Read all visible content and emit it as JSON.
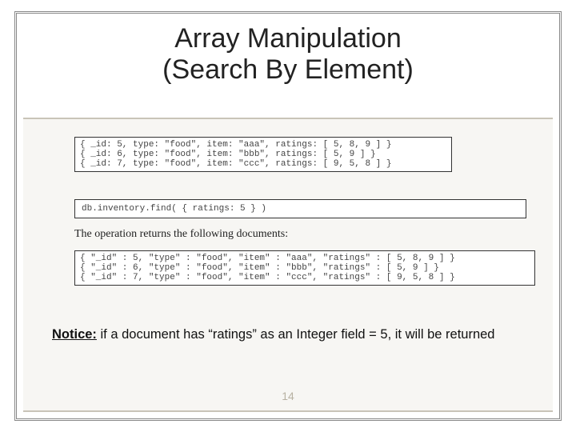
{
  "title": {
    "line1": "Array Manipulation",
    "line2": "(Search By Element)"
  },
  "data_docs": [
    "{ _id: 5, type: \"food\", item: \"aaa\", ratings: [ 5, 8, 9 ] }",
    "{ _id: 6, type: \"food\", item: \"bbb\", ratings: [ 5, 9 ] }",
    "{ _id: 7, type: \"food\", item: \"ccc\", ratings: [ 9, 5, 8 ] }"
  ],
  "query": "db.inventory.find( { ratings: 5 } )",
  "intertext": "The operation returns the following documents:",
  "result_docs": [
    "{ \"_id\" : 5, \"type\" : \"food\", \"item\" : \"aaa\", \"ratings\" : [ 5, 8, 9 ] }",
    "{ \"_id\" : 6, \"type\" : \"food\", \"item\" : \"bbb\", \"ratings\" : [ 5, 9 ] }",
    "{ \"_id\" : 7, \"type\" : \"food\", \"item\" : \"ccc\", \"ratings\" : [ 9, 5, 8 ] }"
  ],
  "notice": {
    "label": "Notice:",
    "text": " if a document has “ratings” as an Integer field = 5, it will be returned"
  },
  "page_number": "14"
}
